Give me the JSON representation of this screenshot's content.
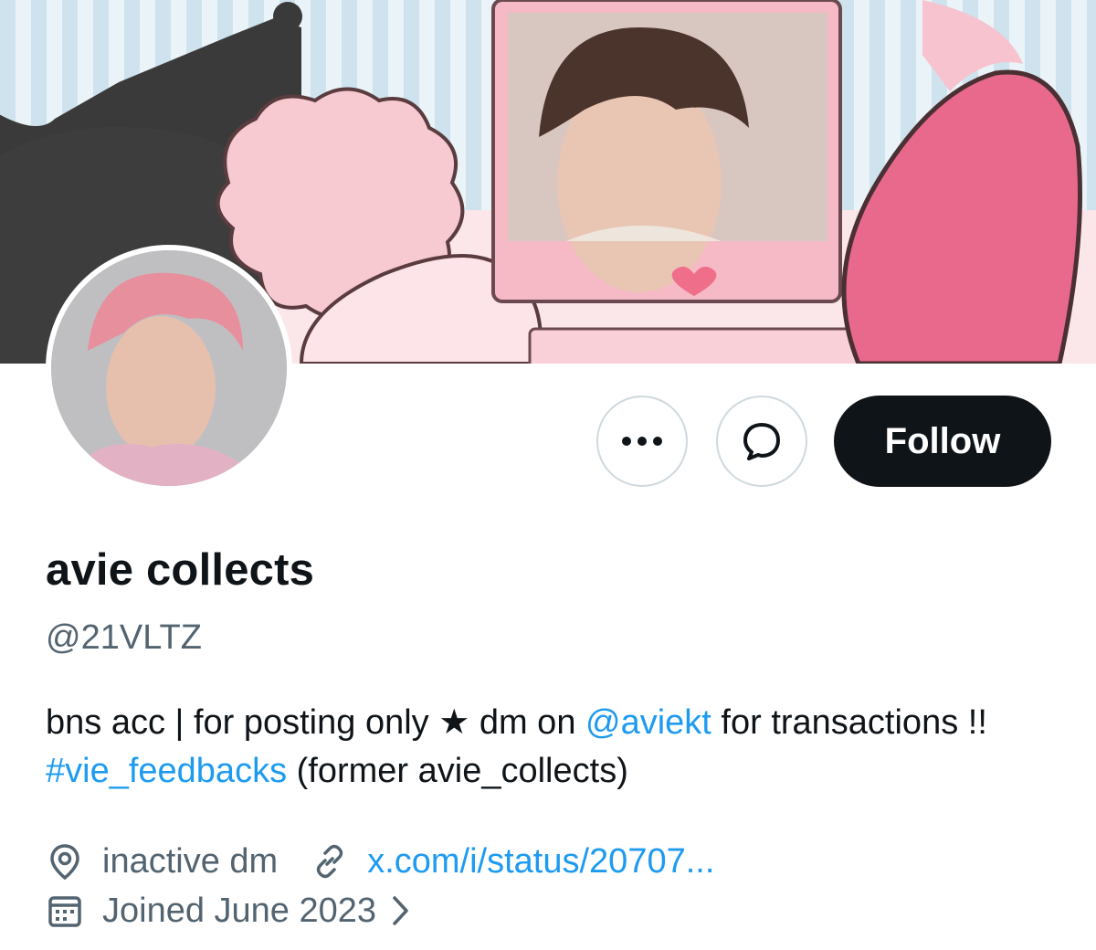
{
  "profile": {
    "display_name": "avie collects",
    "handle": "@21VLTZ",
    "bio": {
      "part1": "bns acc | for posting only ★ dm on ",
      "mention": "@aviekt",
      "part2": " for transactions !! ",
      "hashtag": "#vie_feedbacks",
      "part3": " (former avie_collects)"
    },
    "location": "inactive dm",
    "website": "x.com/i/status/20707...",
    "joined": "Joined June 2023"
  },
  "actions": {
    "follow_label": "Follow"
  },
  "icons": {
    "more": "more-dots-icon",
    "message": "message-bubble-icon",
    "location": "location-pin-icon",
    "link": "link-chain-icon",
    "calendar": "calendar-icon",
    "chevron": "chevron-right-icon"
  },
  "colors": {
    "link": "#1d9bf0",
    "secondary_text": "#536471",
    "follow_bg": "#0f1419"
  }
}
